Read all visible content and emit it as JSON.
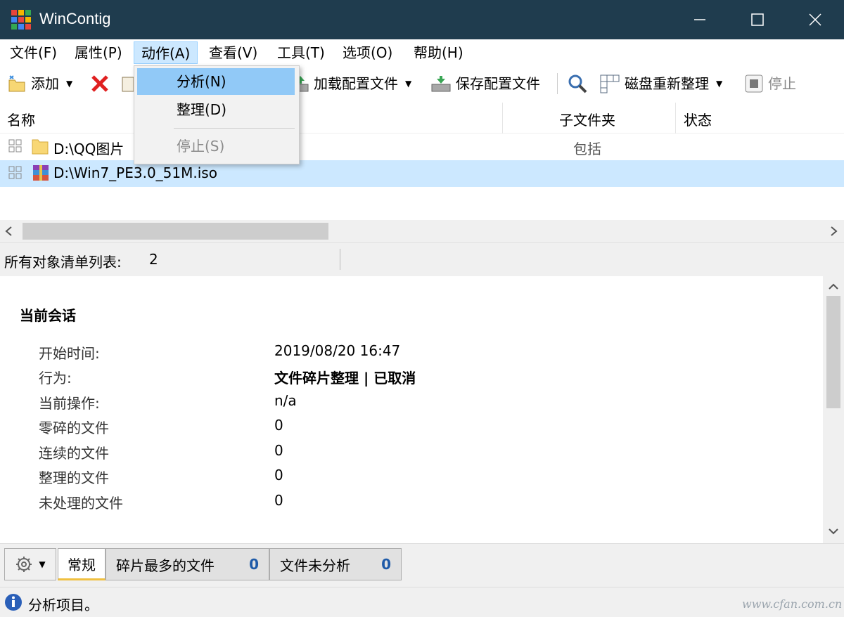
{
  "window": {
    "title": "WinContig",
    "controls": [
      "minimize",
      "maximize",
      "close"
    ]
  },
  "menubar": {
    "items": [
      {
        "label": "文件(F)"
      },
      {
        "label": "属性(P)"
      },
      {
        "label": "动作(A)",
        "active": true
      },
      {
        "label": "查看(V)"
      },
      {
        "label": "工具(T)"
      },
      {
        "label": "选项(O)"
      },
      {
        "label": "帮助(H)"
      }
    ]
  },
  "action_menu": {
    "items": [
      {
        "label": "分析(N)",
        "state": "hover"
      },
      {
        "label": "整理(D)",
        "state": "normal"
      },
      {
        "label": "停止(S)",
        "state": "disabled"
      }
    ]
  },
  "toolbar": {
    "add_label": "添加",
    "load_profile_label": "加载配置文件",
    "save_profile_label": "保存配置文件",
    "defrag_disk_label": "磁盘重新整理",
    "stop_label": "停止"
  },
  "list": {
    "columns": [
      "名称",
      "子文件夹",
      "状态"
    ],
    "rows": [
      {
        "name": "D:\\QQ图片",
        "subfolders": "包括",
        "status": "",
        "icon": "folder-icon",
        "selected": false
      },
      {
        "name": "D:\\Win7_PE3.0_51M.iso",
        "subfolders": "",
        "status": "",
        "icon": "archive-icon",
        "selected": true
      }
    ]
  },
  "summary": {
    "label": "所有对象清单列表:",
    "count": "2"
  },
  "session": {
    "heading": "当前会话",
    "fields": [
      {
        "label": "开始时间:",
        "value": "2019/08/20 16:47",
        "bold": false
      },
      {
        "label": "行为:",
        "value": "文件碎片整理 | 已取消",
        "bold": true
      },
      {
        "label": "当前操作:",
        "value": "n/a",
        "bold": false
      },
      {
        "label": "零碎的文件",
        "value": "0",
        "bold": false
      },
      {
        "label": "连续的文件",
        "value": "0",
        "bold": false
      },
      {
        "label": "整理的文件",
        "value": "0",
        "bold": false
      },
      {
        "label": "未处理的文件",
        "value": "0",
        "bold": false
      }
    ]
  },
  "tabs": [
    {
      "label": "常规",
      "count": "",
      "active": true
    },
    {
      "label": "碎片最多的文件",
      "count": "0",
      "active": false
    },
    {
      "label": "文件未分析",
      "count": "0",
      "active": false
    }
  ],
  "status": {
    "text": "分析项目。"
  },
  "watermark": "www.cfan.com.cn",
  "colors": {
    "titlebar": "#1f3c4e",
    "selection": "#cce8ff",
    "menu_hover": "#91c9f7",
    "tab_count": "#1e5aa8"
  }
}
